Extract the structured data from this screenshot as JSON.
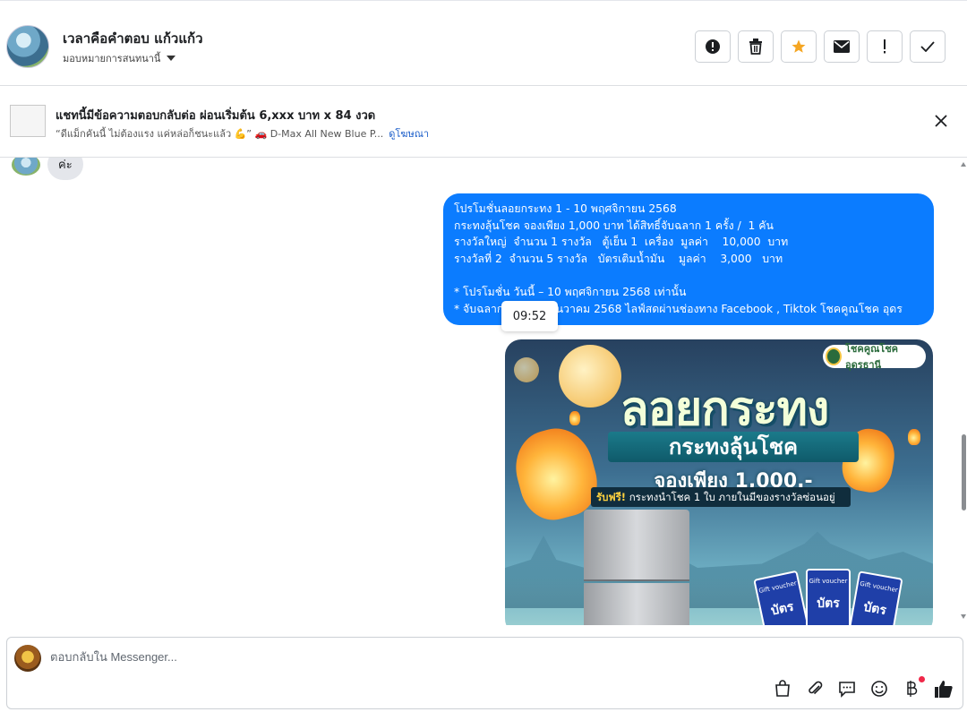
{
  "header": {
    "contact_name": "เวลาคือคำตอบ แก้วแก้ว",
    "assign_label": "มอบหมายการสนทนานี้"
  },
  "toolbar": {
    "buttons": [
      "report-icon",
      "delete-icon",
      "star-icon",
      "mail-icon",
      "exclamation-icon",
      "check-icon"
    ],
    "star_color": "#f5a623"
  },
  "ad": {
    "title": "แชทนี้มีข้อความตอบกลับต่อ ผ่อนเริ่มต้น 6,xxx บาท x 84 งวด",
    "subtitle": "“ดีแม็กคันนี้ ไม่ต้องแรง แค่หล่อก็ชนะแล้ว 💪” 🚗 D-Max All New Blue P...",
    "link": "ดูโฆษณา"
  },
  "chat": {
    "received_text": "ค่ะ",
    "sent_message": "โปรโมชั่นลอยกระทง 1 - 10 พฤศจิกายน 2568\nกระทงลุ้นโชค จองเพียง 1,000 บาท ได้สิทธิ์จับฉลาก 1 ครั้ง /  1 คัน\nรางวัลใหญ่  จำนวน 1 รางวัล   ตู้เย็น 1  เครื่อง  มูลค่า    10,000  บาท\nรางวัลที่ 2  จำนวน 5 รางวัล   บัตรเติมน้ำมัน    มูลค่า    3,000   บาท\n\n* โปรโมชั่น วันนี้ – 10 พฤศจิกายน 2568 เท่านั้น\n* จับฉลาก             ธันวาคม 2568 ไลฟ์สดผ่านช่องทาง Facebook , Tiktok โชคคูณโชค อุดร",
    "timestamp_tooltip": "09:52",
    "promo": {
      "brand": "โชคคูณโชค อุดรธานี",
      "headline": "ลอยกระทง",
      "subheadline": "กระทงลุ้นโชค",
      "price_line": "จองเพียง 1,000.-",
      "free_label": "รับฟรี!",
      "free_text": "กระทงนำโชค 1 ใบ ภายในมีของรางวัลซ่อนอยู่",
      "voucher_label": "Gift voucher",
      "voucher_sub": "บัตร"
    }
  },
  "composer": {
    "placeholder": "ตอบกลับใน Messenger...",
    "tools": [
      "bag-icon",
      "attach-icon",
      "chat-bubble-icon",
      "emoji-icon",
      "baht-icon",
      "like-icon"
    ]
  }
}
